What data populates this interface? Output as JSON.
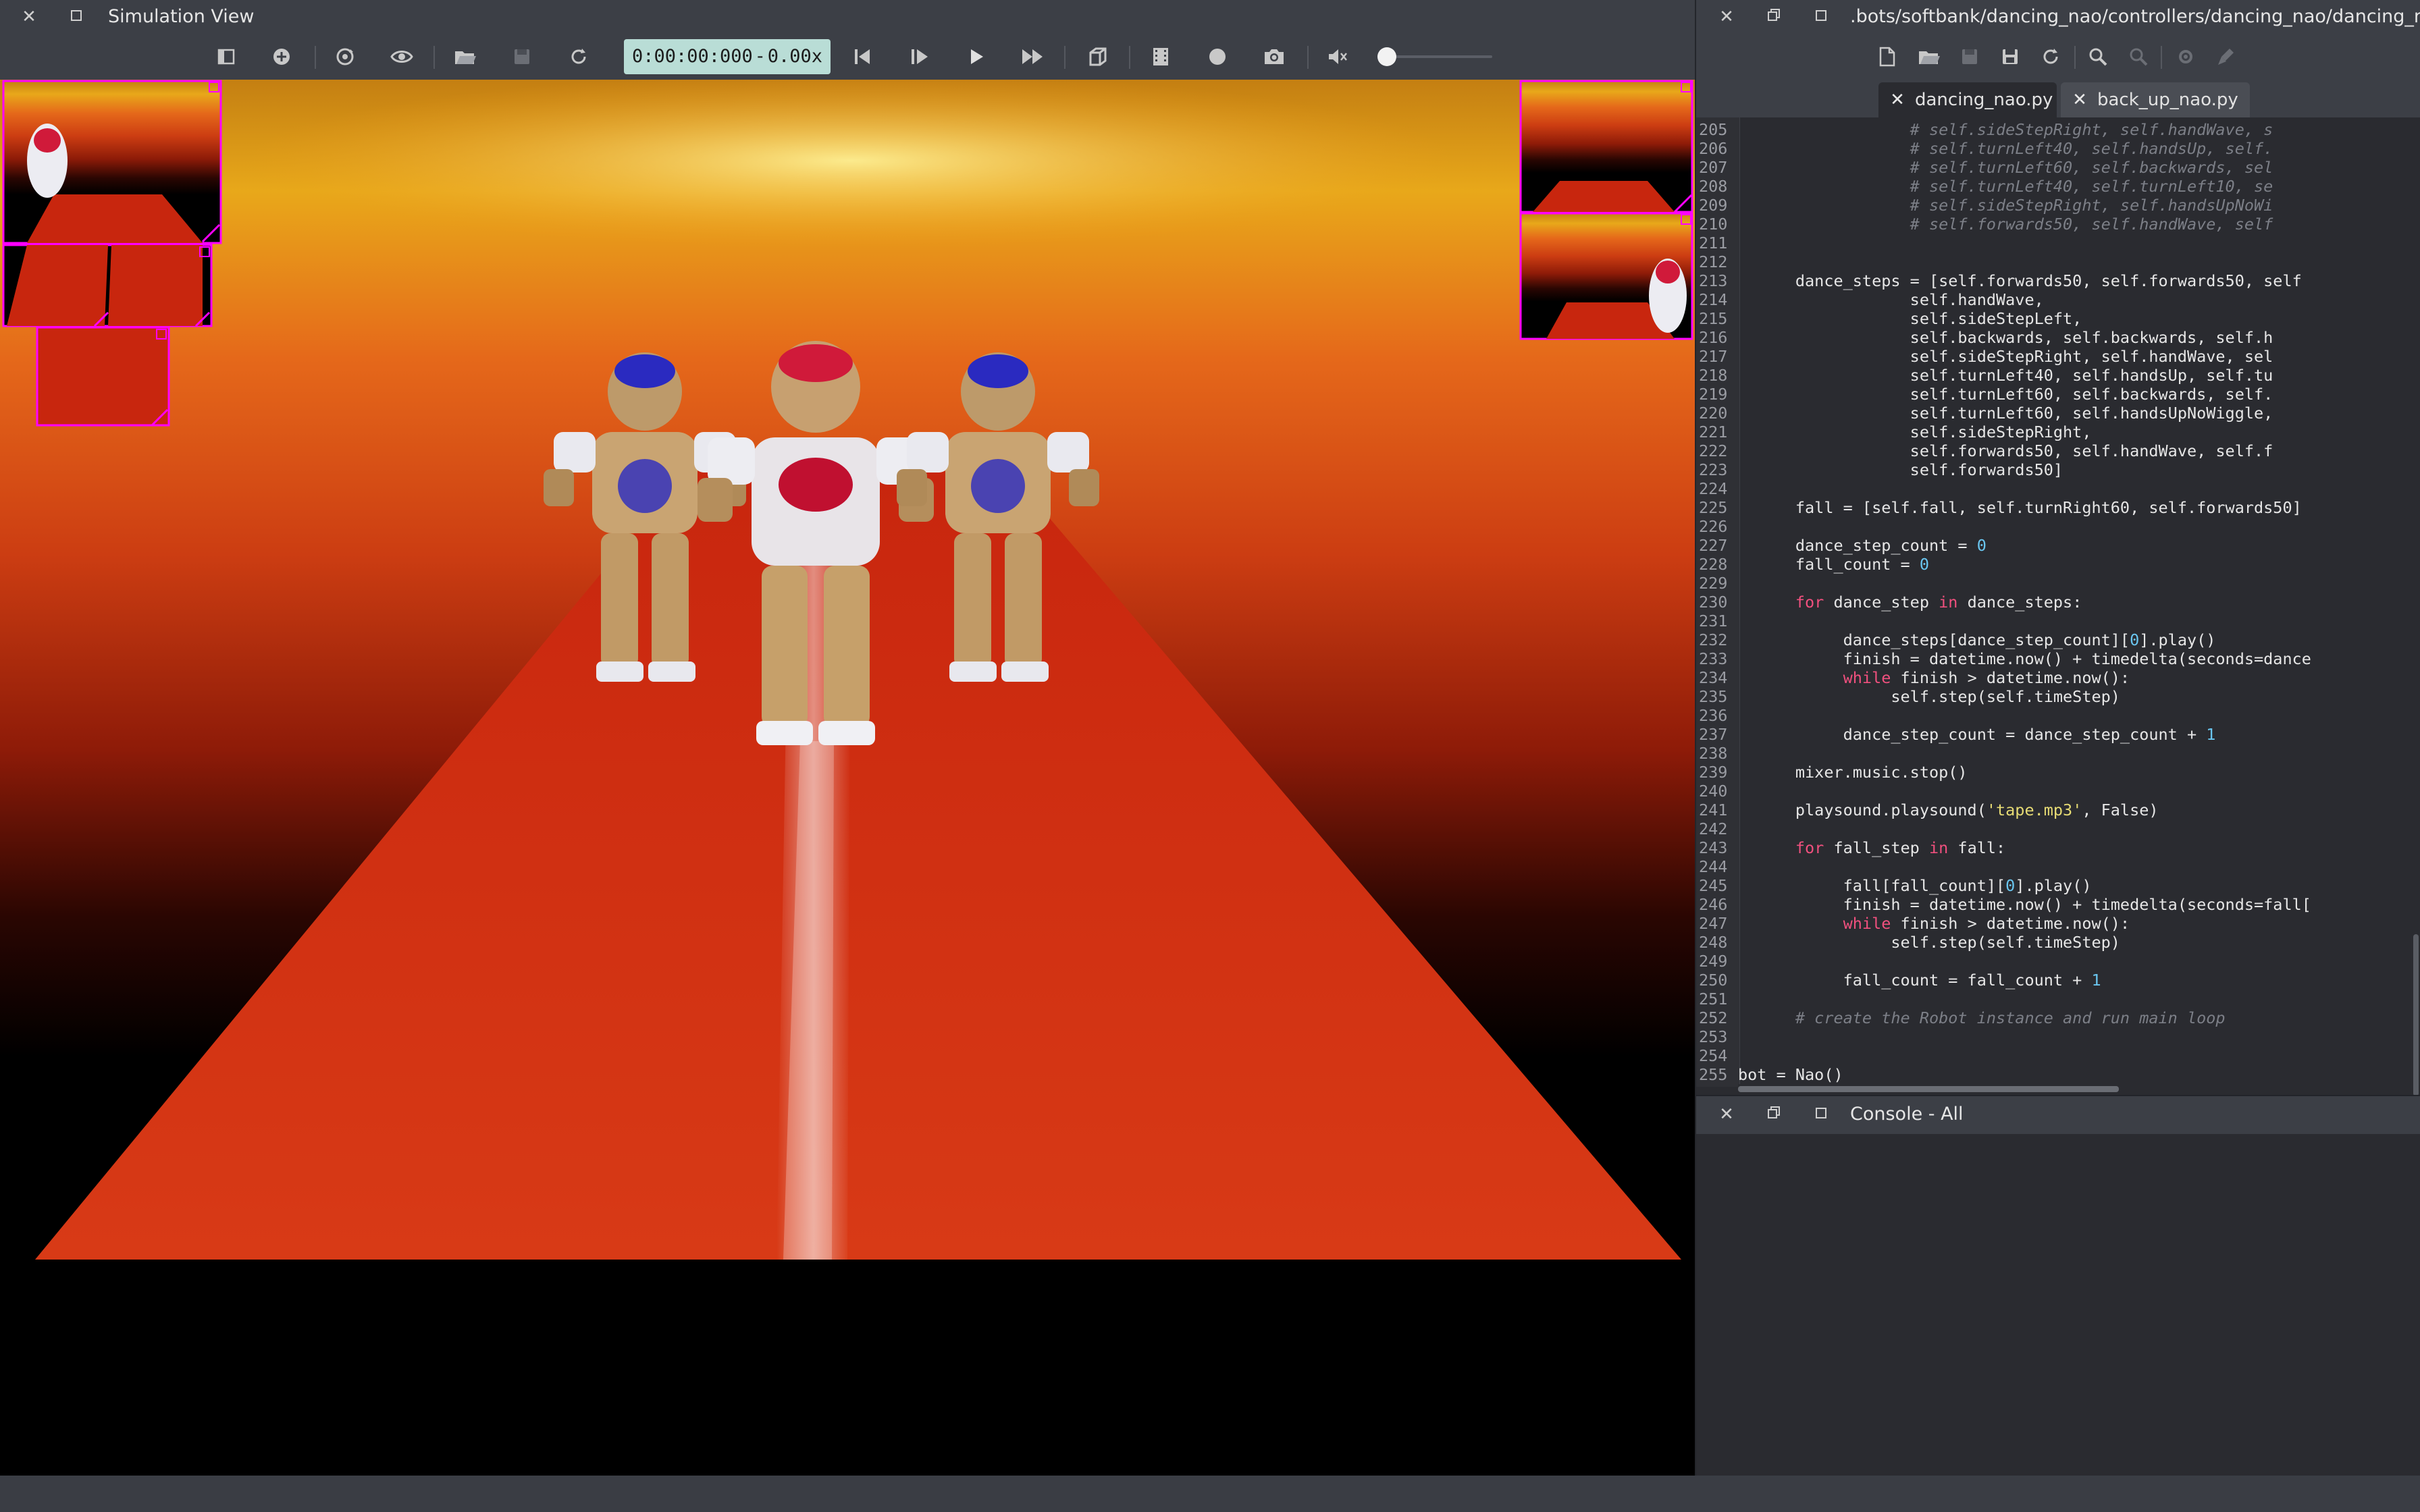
{
  "simulation": {
    "title": "Simulation View",
    "time": "0:00:00:000",
    "time_sep": "-",
    "speed": "0.00x",
    "toolbar_icons": [
      "sidebar-toggle-icon",
      "add-node-icon",
      "view-rotate-icon",
      "eye-icon",
      "open-folder-icon",
      "save-world-icon",
      "reload-icon",
      "step-back-icon",
      "step-icon",
      "play-icon",
      "fast-forward-icon",
      "cube-view-icon",
      "film-icon",
      "record-icon",
      "camera-icon",
      "mute-icon"
    ],
    "volume_level": 0.0,
    "scene_colors": {
      "sky_top": "#e6a51a",
      "sky_mid": "#e35a10",
      "floor": "#d22a10",
      "background": "#000000",
      "overlay_border": "#ff00ff"
    }
  },
  "editor": {
    "title": ".bots/softbank/dancing_nao/controllers/dancing_nao/dancing_nao.py",
    "toolbar_icons": [
      "new-file-icon",
      "open-file-icon",
      "save-icon",
      "save-as-icon",
      "revert-icon",
      "find-icon",
      "replace-icon",
      "build-icon",
      "clean-icon"
    ],
    "tabs": [
      {
        "label": "dancing_nao.py",
        "active": true
      },
      {
        "label": "back_up_nao.py",
        "active": false
      }
    ],
    "lines": [
      {
        "n": "205",
        "t": "                  # self.sideStepRight, self.handWave, s",
        "k": "cmt"
      },
      {
        "n": "206",
        "t": "                  # self.turnLeft40, self.handsUp, self.",
        "k": "cmt"
      },
      {
        "n": "207",
        "t": "                  # self.turnLeft60, self.backwards, sel",
        "k": "cmt"
      },
      {
        "n": "208",
        "t": "                  # self.turnLeft40, self.turnLeft10, se",
        "k": "cmt"
      },
      {
        "n": "209",
        "t": "                  # self.sideStepRight, self.handsUpNoWi",
        "k": "cmt"
      },
      {
        "n": "210",
        "t": "                  # self.forwards50, self.handWave, self",
        "k": "cmt"
      },
      {
        "n": "211",
        "t": "",
        "k": "plain"
      },
      {
        "n": "212",
        "t": "",
        "k": "plain"
      },
      {
        "n": "213",
        "t": "      dance_steps = [self.forwards50, self.forwards50, self",
        "k": "plain"
      },
      {
        "n": "214",
        "t": "                  self.handWave,",
        "k": "plain"
      },
      {
        "n": "215",
        "t": "                  self.sideStepLeft,",
        "k": "plain"
      },
      {
        "n": "216",
        "t": "                  self.backwards, self.backwards, self.h",
        "k": "plain"
      },
      {
        "n": "217",
        "t": "                  self.sideStepRight, self.handWave, sel",
        "k": "plain"
      },
      {
        "n": "218",
        "t": "                  self.turnLeft40, self.handsUp, self.tu",
        "k": "plain"
      },
      {
        "n": "219",
        "t": "                  self.turnLeft60, self.backwards, self.",
        "k": "plain"
      },
      {
        "n": "220",
        "t": "                  self.turnLeft60, self.handsUpNoWiggle,",
        "k": "plain"
      },
      {
        "n": "221",
        "t": "                  self.sideStepRight,",
        "k": "plain"
      },
      {
        "n": "222",
        "t": "                  self.forwards50, self.handWave, self.f",
        "k": "plain"
      },
      {
        "n": "223",
        "t": "                  self.forwards50]",
        "k": "plain"
      },
      {
        "n": "224",
        "t": "",
        "k": "plain"
      },
      {
        "n": "225",
        "t": "      fall = [self.fall, self.turnRight60, self.forwards50]",
        "k": "plain"
      },
      {
        "n": "226",
        "t": "",
        "k": "plain"
      },
      {
        "n": "227",
        "t": "      dance_step_count = 0",
        "k": "plain"
      },
      {
        "n": "228",
        "t": "      fall_count = 0",
        "k": "plain"
      },
      {
        "n": "229",
        "t": "",
        "k": "plain"
      },
      {
        "n": "230",
        "t": "      for dance_step in dance_steps:",
        "k": "plain"
      },
      {
        "n": "231",
        "t": "",
        "k": "plain"
      },
      {
        "n": "232",
        "t": "           dance_steps[dance_step_count][0].play()",
        "k": "plain"
      },
      {
        "n": "233",
        "t": "           finish = datetime.now() + timedelta(seconds=dance",
        "k": "plain"
      },
      {
        "n": "234",
        "t": "           while finish > datetime.now():",
        "k": "plain"
      },
      {
        "n": "235",
        "t": "                self.step(self.timeStep)",
        "k": "plain"
      },
      {
        "n": "236",
        "t": "",
        "k": "plain"
      },
      {
        "n": "237",
        "t": "           dance_step_count = dance_step_count + 1",
        "k": "plain"
      },
      {
        "n": "238",
        "t": "",
        "k": "plain"
      },
      {
        "n": "239",
        "t": "      mixer.music.stop()",
        "k": "plain"
      },
      {
        "n": "240",
        "t": "",
        "k": "plain"
      },
      {
        "n": "241",
        "t": "      playsound.playsound('tape.mp3', False)",
        "k": "plain"
      },
      {
        "n": "242",
        "t": "",
        "k": "plain"
      },
      {
        "n": "243",
        "t": "      for fall_step in fall:",
        "k": "plain"
      },
      {
        "n": "244",
        "t": "",
        "k": "plain"
      },
      {
        "n": "245",
        "t": "           fall[fall_count][0].play()",
        "k": "plain"
      },
      {
        "n": "246",
        "t": "           finish = datetime.now() + timedelta(seconds=fall[",
        "k": "plain"
      },
      {
        "n": "247",
        "t": "           while finish > datetime.now():",
        "k": "plain"
      },
      {
        "n": "248",
        "t": "                self.step(self.timeStep)",
        "k": "plain"
      },
      {
        "n": "249",
        "t": "",
        "k": "plain"
      },
      {
        "n": "250",
        "t": "           fall_count = fall_count + 1",
        "k": "plain"
      },
      {
        "n": "251",
        "t": "",
        "k": "plain"
      },
      {
        "n": "252",
        "t": "      # create the Robot instance and run main loop",
        "k": "cmt"
      },
      {
        "n": "253",
        "t": "",
        "k": "plain"
      },
      {
        "n": "254",
        "t": "",
        "k": "plain"
      },
      {
        "n": "255",
        "t": "bot = Nao()",
        "k": "plain"
      }
    ]
  },
  "console": {
    "title": "Console - All"
  }
}
